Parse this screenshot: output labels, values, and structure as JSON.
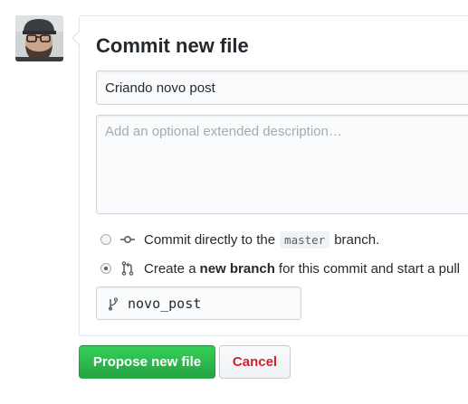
{
  "heading": "Commit new file",
  "summary": {
    "value": "Criando novo post"
  },
  "description": {
    "placeholder": "Add an optional extended description…"
  },
  "options": {
    "direct": {
      "prefix": "Commit directly to the",
      "branch": "master",
      "suffix": "branch.",
      "checked": false,
      "icon": "git-commit-icon"
    },
    "new_branch": {
      "prefix": "Create a",
      "bold": "new branch",
      "suffix": "for this commit and start a pull",
      "checked": true,
      "icon": "git-pull-request-icon"
    }
  },
  "branch_name": {
    "value": "novo_post",
    "icon": "git-branch-icon"
  },
  "buttons": {
    "propose": "Propose new file",
    "cancel": "Cancel"
  },
  "colors": {
    "primary_green": "#28a745",
    "cancel_red": "#cb2431",
    "border": "#e1e4e8"
  }
}
